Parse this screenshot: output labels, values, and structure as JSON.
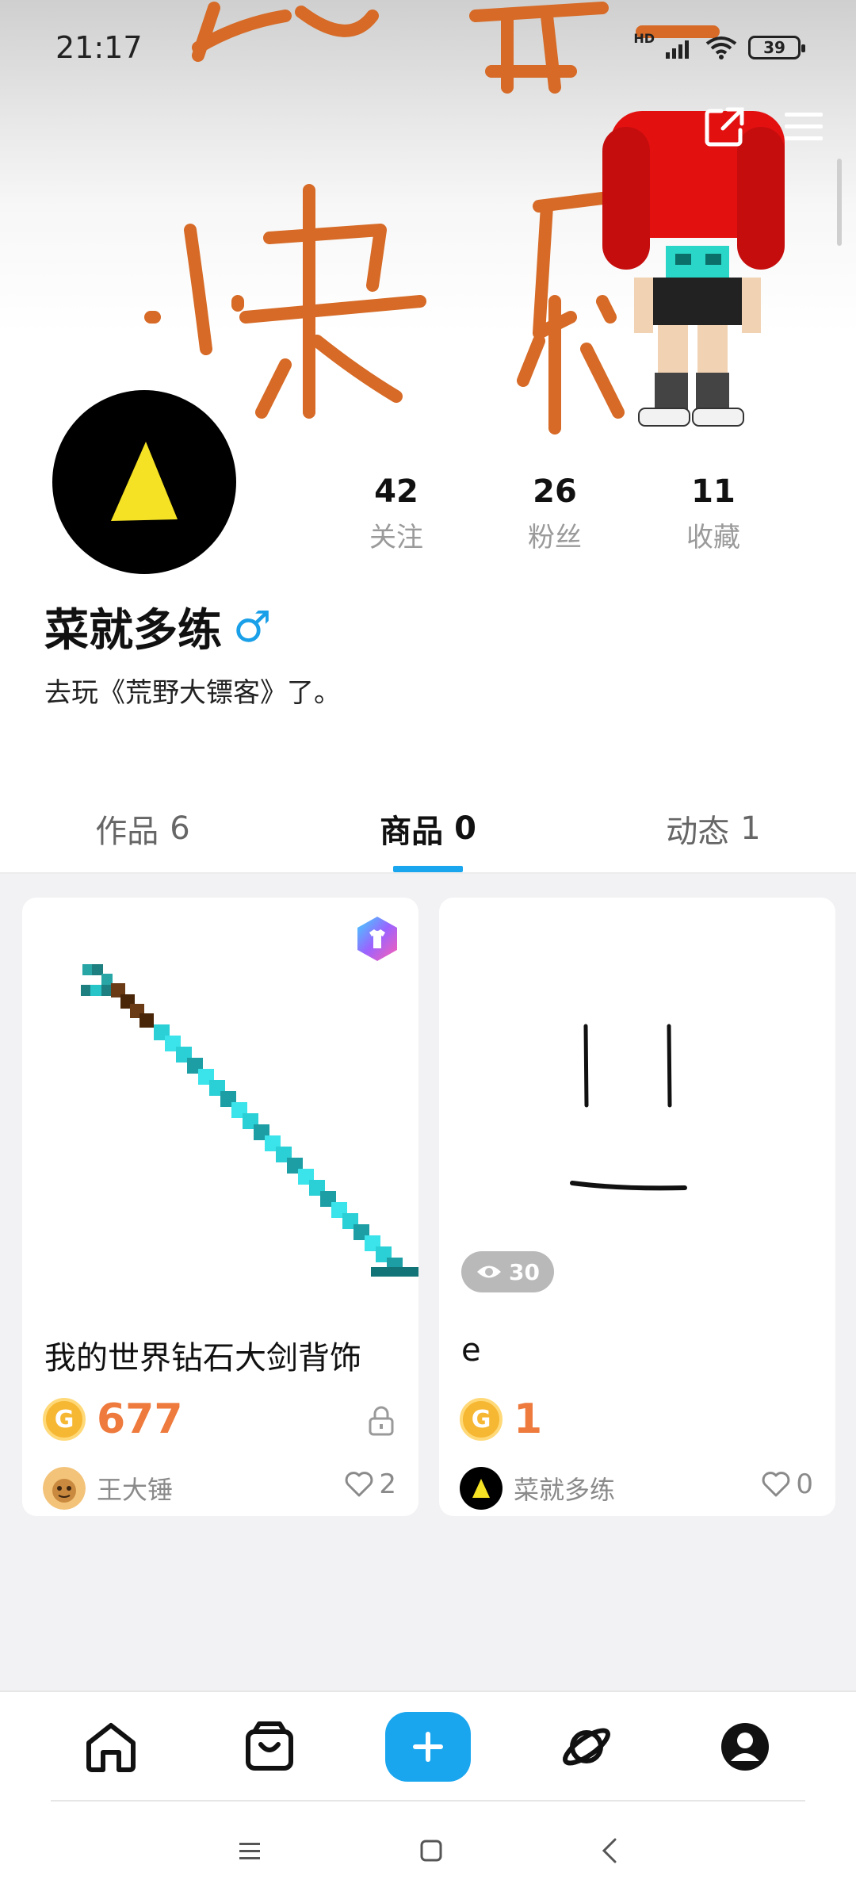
{
  "status_bar": {
    "time": "21:17",
    "network": "HD",
    "battery": "39"
  },
  "profile": {
    "username": "菜就多练",
    "gender_symbol": "♂",
    "bio": "去玩《荒野大镖客》了。",
    "stats": [
      {
        "value": "42",
        "label": "关注"
      },
      {
        "value": "26",
        "label": "粉丝"
      },
      {
        "value": "11",
        "label": "收藏"
      }
    ]
  },
  "tabs": [
    {
      "label": "作品",
      "count": "6",
      "active": false
    },
    {
      "label": "商品",
      "count": "0",
      "active": true
    },
    {
      "label": "动态",
      "count": "1",
      "active": false
    }
  ],
  "products": [
    {
      "title": "我的世界钻石大剑背饰",
      "price": "677",
      "author": "王大锤",
      "likes": "2",
      "locked": true
    },
    {
      "title": "e",
      "price": "1",
      "author": "菜就多练",
      "likes": "0",
      "views": "30"
    }
  ],
  "coin_symbol": "G",
  "colors": {
    "accent": "#1aa6ef",
    "price": "#ee7a3d",
    "gender": "#1aa0e8"
  },
  "icons": {
    "top_actions": [
      "share-icon",
      "menu-icon"
    ],
    "bottom_nav": [
      "home-icon",
      "shop-bag-icon",
      "plus-icon",
      "planet-icon",
      "profile-icon"
    ],
    "system_nav": [
      "recents-icon",
      "home-square-icon",
      "back-icon"
    ]
  }
}
